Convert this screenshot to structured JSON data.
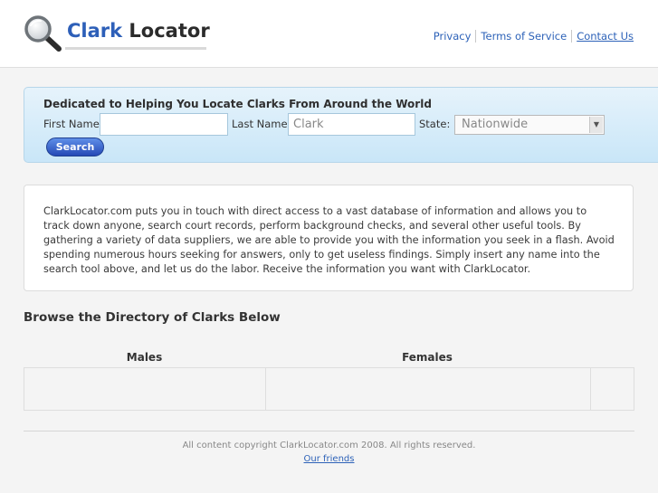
{
  "header": {
    "logo_word1": "Clark",
    "logo_word2": "Locator",
    "nav": {
      "privacy": "Privacy",
      "terms": "Terms of Service",
      "contact": "Contact Us"
    }
  },
  "search": {
    "title": "Dedicated to Helping You Locate Clarks From Around the World",
    "first_name_label": "First Name",
    "first_name_value": "",
    "last_name_label": "Last Name",
    "last_name_value": "Clark",
    "state_label": "State:",
    "state_selected": "Nationwide",
    "button_label": "Search"
  },
  "intro": {
    "text": "ClarkLocator.com puts you in touch with direct access to a vast database of information and allows you to track down anyone, search court records, perform background checks, and several other useful tools. By gathering a variety of data suppliers, we are able to provide you with the information you seek in a flash. Avoid spending numerous hours seeking for answers, only to get useless findings. Simply insert any name into the search tool above, and let us do the labor. Receive the information you want with ClarkLocator."
  },
  "directory": {
    "title": "Browse the Directory of Clarks Below",
    "columns": [
      "Males",
      "Females"
    ]
  },
  "footer": {
    "copyright": "All content copyright ClarkLocator.com 2008. All rights reserved.",
    "friends_link": "Our friends"
  },
  "colors": {
    "brand_blue": "#2d5fb8",
    "search_button": "#2549b6",
    "panel_bg": "#c9e6f8"
  },
  "icons": {
    "logo": "magnifier-icon",
    "select": "chevron-down-icon"
  }
}
